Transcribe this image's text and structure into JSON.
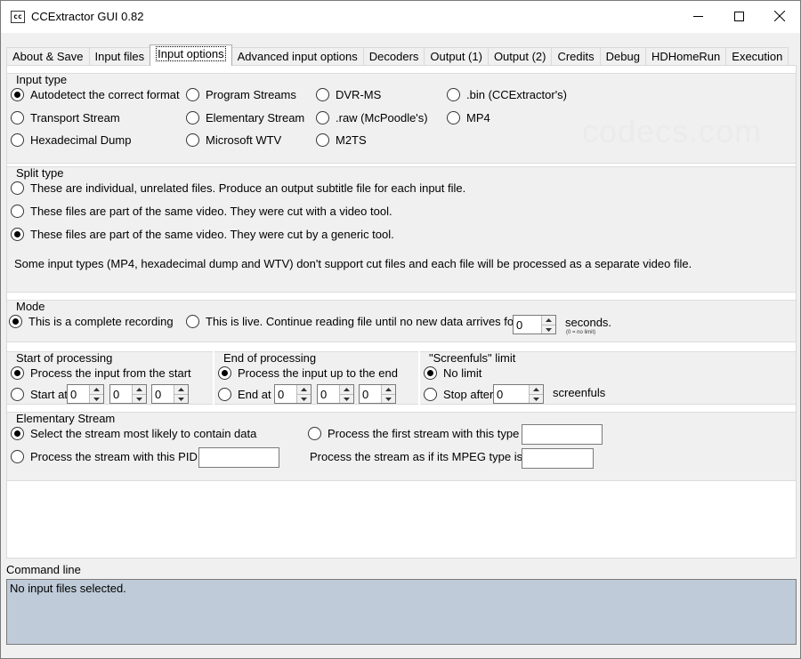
{
  "window": {
    "title": "CCExtractor GUI 0.82",
    "icon_text": "cc"
  },
  "tabs": [
    {
      "label": "About & Save",
      "active": false
    },
    {
      "label": "Input files",
      "active": false
    },
    {
      "label": "Input options",
      "active": true
    },
    {
      "label": "Advanced input options",
      "active": false
    },
    {
      "label": "Decoders",
      "active": false
    },
    {
      "label": "Output (1)",
      "active": false
    },
    {
      "label": "Output (2)",
      "active": false
    },
    {
      "label": "Credits",
      "active": false
    },
    {
      "label": "Debug",
      "active": false
    },
    {
      "label": "HDHomeRun",
      "active": false
    },
    {
      "label": "Execution",
      "active": false
    }
  ],
  "watermark": "codecs.com",
  "input_type": {
    "title": "Input type",
    "options": [
      {
        "label": "Autodetect the correct format",
        "selected": true
      },
      {
        "label": "Program Streams",
        "selected": false
      },
      {
        "label": "DVR-MS",
        "selected": false
      },
      {
        "label": ".bin (CCExtractor's)",
        "selected": false
      },
      {
        "label": "Transport Stream",
        "selected": false
      },
      {
        "label": "Elementary Stream",
        "selected": false
      },
      {
        "label": ".raw (McPoodle's)",
        "selected": false
      },
      {
        "label": "MP4",
        "selected": false
      },
      {
        "label": "Hexadecimal Dump",
        "selected": false
      },
      {
        "label": "Microsoft WTV",
        "selected": false
      },
      {
        "label": "M2TS",
        "selected": false
      }
    ]
  },
  "split_type": {
    "title": "Split type",
    "options": [
      {
        "label": "These are individual, unrelated files. Produce an output subtitle file for each input file.",
        "selected": false
      },
      {
        "label": "These files are part of the same video. They were cut with a video tool.",
        "selected": false
      },
      {
        "label": "These files are part of the same video. They were cut by a generic tool.",
        "selected": true
      }
    ],
    "note": "Some input types (MP4, hexadecimal dump and WTV) don't support cut files and each file will be processed as a separate video file."
  },
  "mode": {
    "title": "Mode",
    "complete_label": "This is a complete recording",
    "complete_selected": true,
    "live_label": "This is live. Continue reading file until no new data arrives for",
    "live_selected": false,
    "live_value": "0",
    "seconds_label": "seconds.",
    "seconds_note": "(0 = no limit)"
  },
  "start_processing": {
    "title": "Start of processing",
    "from_start_label": "Process the input from the start",
    "from_start_selected": true,
    "start_at_label": "Start at",
    "start_at_selected": false,
    "values": [
      "0",
      "0",
      "0"
    ]
  },
  "end_processing": {
    "title": "End of processing",
    "to_end_label": "Process the input up to the end",
    "to_end_selected": true,
    "end_at_label": "End at",
    "end_at_selected": false,
    "values": [
      "0",
      "0",
      "0"
    ]
  },
  "screenfuls": {
    "title": "\"Screenfuls\" limit",
    "no_limit_label": "No limit",
    "no_limit_selected": true,
    "stop_after_label": "Stop after",
    "stop_after_selected": false,
    "value": "0",
    "unit_label": "screenfuls"
  },
  "elementary_stream": {
    "title": "Elementary Stream",
    "likely_label": "Select the stream most likely to contain data",
    "likely_selected": true,
    "first_type_label": "Process the first stream with this type",
    "first_type_selected": false,
    "first_type_value": "",
    "pid_label": "Process the stream with this PID",
    "pid_selected": false,
    "pid_value": "",
    "mpeg_type_label": "Process the stream as if its MPEG type is",
    "mpeg_type_value": ""
  },
  "command_line": {
    "label": "Command line",
    "text": "No input files selected."
  }
}
